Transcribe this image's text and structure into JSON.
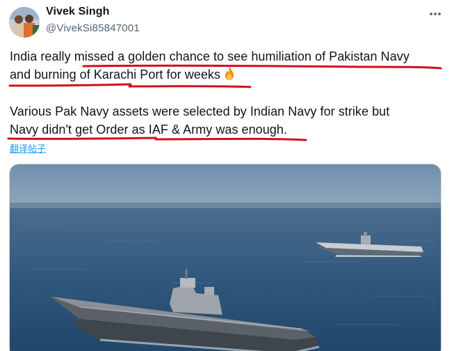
{
  "author": {
    "display_name": "Vivek Singh",
    "handle": "@VivekSi85847001"
  },
  "post": {
    "paragraph_1_line_1": "India really missed a golden chance to see humiliation of Pakistan Navy",
    "paragraph_1_line_2": "and burning of Karachi Port for weeks",
    "paragraph_2_line_1": "Various Pak Navy assets were selected by Indian Navy for strike but",
    "paragraph_2_line_2": "Navy didn't get Order as IAF & Army was enough.",
    "translate_label": "翻译帖子",
    "emoji": "fire-emoji"
  },
  "icons": {
    "more": "more-dots-icon",
    "fire": "fire-icon"
  },
  "colors": {
    "text": "#0f1419",
    "secondary_text": "#536471",
    "link": "#1d9bf0",
    "annotation_red": "#d0101b"
  },
  "media": {
    "description_kind": "photo",
    "alt": ""
  }
}
